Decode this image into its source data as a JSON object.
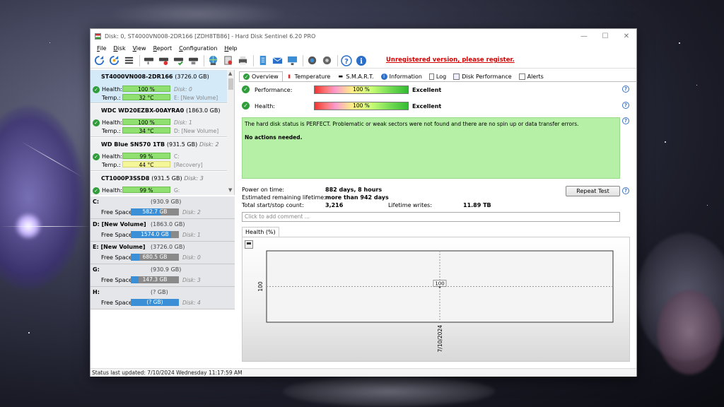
{
  "window": {
    "title": "Disk: 0, ST4000VN008-2DR166 [ZDH8TB86]  -  Hard Disk Sentinel 6.20 PRO",
    "minimize": "—",
    "maximize": "☐",
    "close": "✕"
  },
  "menu": [
    "File",
    "Disk",
    "View",
    "Report",
    "Configuration",
    "Help"
  ],
  "toolbar": {
    "unregistered": "Unregistered version, please register."
  },
  "disks": [
    {
      "name": "ST4000VN008-2DR166",
      "capacity": "(3726.0 GB)",
      "disk_no": "",
      "health": "100 %",
      "health_color": "green",
      "temp": "32 °C",
      "temp_color": "green",
      "health_right": "Disk: 0",
      "temp_right": "E: [New Volume]",
      "selected": true
    },
    {
      "name": "WDC WD20EZBX-00AYRA0",
      "capacity": "(1863.0 GB)",
      "disk_no": "",
      "health": "100 %",
      "health_color": "green",
      "temp": "34 °C",
      "temp_color": "green",
      "health_right": "Disk: 1",
      "temp_right": "D: [New Volume]",
      "selected": false
    },
    {
      "name": "WD Blue SN570 1TB",
      "capacity": "(931.5 GB)",
      "disk_no": "Disk: 2",
      "health": "99 %",
      "health_color": "green",
      "temp": "44 °C",
      "temp_color": "yellow",
      "health_right": "C:",
      "temp_right": "[Recovery]",
      "selected": false
    },
    {
      "name": "CT1000P3SSD8",
      "capacity": "(931.5 GB)",
      "disk_no": "Disk: 3",
      "health": "99 %",
      "health_color": "green",
      "temp": "",
      "temp_color": "green",
      "health_right": "G:",
      "temp_right": "",
      "selected": false
    }
  ],
  "labels": {
    "health": "Health:",
    "temp": "Temp.:",
    "free_space": "Free Space"
  },
  "volumes": [
    {
      "name": "C:",
      "capacity": "(930.9 GB)",
      "free": "582.7 GB",
      "free_ratio": 0.63,
      "disk": "Disk: 2"
    },
    {
      "name": "D: [New Volume]",
      "capacity": "(1863.0 GB)",
      "free": "1574.0 GB",
      "free_ratio": 0.84,
      "disk": "Disk: 1"
    },
    {
      "name": "E: [New Volume]",
      "capacity": "(3726.0 GB)",
      "free": "680.5 GB",
      "free_ratio": 0.18,
      "disk": "Disk: 0"
    },
    {
      "name": "G:",
      "capacity": "(930.9 GB)",
      "free": "147.3 GB",
      "free_ratio": 0.16,
      "disk": "Disk: 3"
    },
    {
      "name": "H:",
      "capacity": "(? GB)",
      "free": "(? GB)",
      "free_ratio": 1.0,
      "disk": "Disk: 4"
    }
  ],
  "tabs": [
    {
      "label": "Overview",
      "icon": "check-icon",
      "active": true
    },
    {
      "label": "Temperature",
      "icon": "thermometer-icon",
      "active": false
    },
    {
      "label": "S.M.A.R.T.",
      "icon": "smart-icon",
      "active": false
    },
    {
      "label": "Information",
      "icon": "info-icon",
      "active": false
    },
    {
      "label": "Log",
      "icon": "log-icon",
      "active": false
    },
    {
      "label": "Disk Performance",
      "icon": "performance-icon",
      "active": false
    },
    {
      "label": "Alerts",
      "icon": "alerts-icon",
      "active": false
    }
  ],
  "overview": {
    "performance_label": "Performance:",
    "performance_value": "100 %",
    "performance_rating": "Excellent",
    "health_label": "Health:",
    "health_value": "100 %",
    "health_rating": "Excellent",
    "status_text": "The hard disk status is PERFECT. Problematic or weak sectors were not found and there are no spin up or data transfer errors.",
    "actions_text": "No actions needed.",
    "power_on_label": "Power on time:",
    "power_on_value": "882 days, 8 hours",
    "remaining_label": "Estimated remaining lifetime:",
    "remaining_value": "more than 942 days",
    "startstop_label": "Total start/stop count:",
    "startstop_value": "3,216",
    "writes_label": "Lifetime writes:",
    "writes_value": "11.89 TB",
    "repeat_button": "Repeat Test",
    "comment_placeholder": "Click to add comment ..."
  },
  "chart_data": {
    "type": "line",
    "title": "Health (%)",
    "x": [
      "7/10/2024"
    ],
    "series": [
      {
        "values": [
          100
        ]
      }
    ],
    "ylabel": "",
    "xlabel": "",
    "y_tick": "100",
    "point_label": "100"
  },
  "status_bar": "Status last updated: 7/10/2024 Wednesday 11:17:59 AM"
}
